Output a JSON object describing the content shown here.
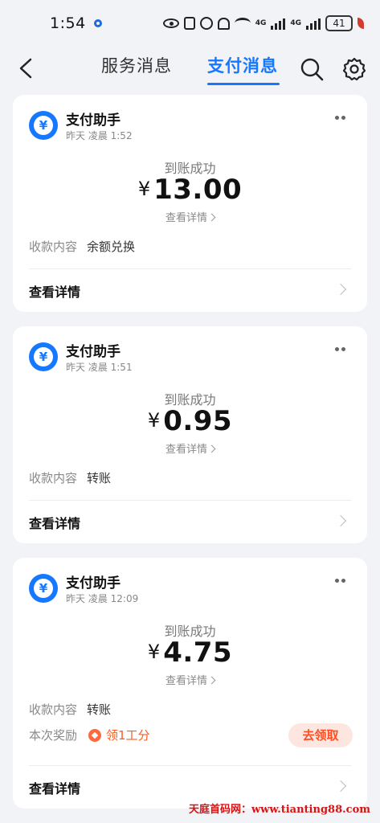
{
  "status_bar": {
    "time": "1:54",
    "network_1": "4G",
    "network_2": "4G",
    "battery": "41"
  },
  "header": {
    "tabs": [
      {
        "label": "服务消息",
        "active": false
      },
      {
        "label": "支付消息",
        "active": true
      }
    ],
    "accent_color": "#1677ff"
  },
  "cards": [
    {
      "sender": "支付助手",
      "time": "昨天 凌晨 1:52",
      "status": "到账成功",
      "currency": "¥",
      "amount": "13.00",
      "detail_link": "查看详情",
      "content_label": "收款内容",
      "content_value": "余额兑换",
      "footer_label": "查看详情"
    },
    {
      "sender": "支付助手",
      "time": "昨天 凌晨 1:51",
      "status": "到账成功",
      "currency": "¥",
      "amount": "0.95",
      "detail_link": "查看详情",
      "content_label": "收款内容",
      "content_value": "转账",
      "footer_label": "查看详情"
    },
    {
      "sender": "支付助手",
      "time": "昨天 凌晨 12:09",
      "status": "到账成功",
      "currency": "¥",
      "amount": "4.75",
      "detail_link": "查看详情",
      "content_label": "收款内容",
      "content_value": "转账",
      "reward_label": "本次奖励",
      "reward_value": "领1工分",
      "claim_button": "去领取",
      "footer_label": "查看详情"
    }
  ],
  "watermark": "天庭首码网：www.tianting88.com"
}
